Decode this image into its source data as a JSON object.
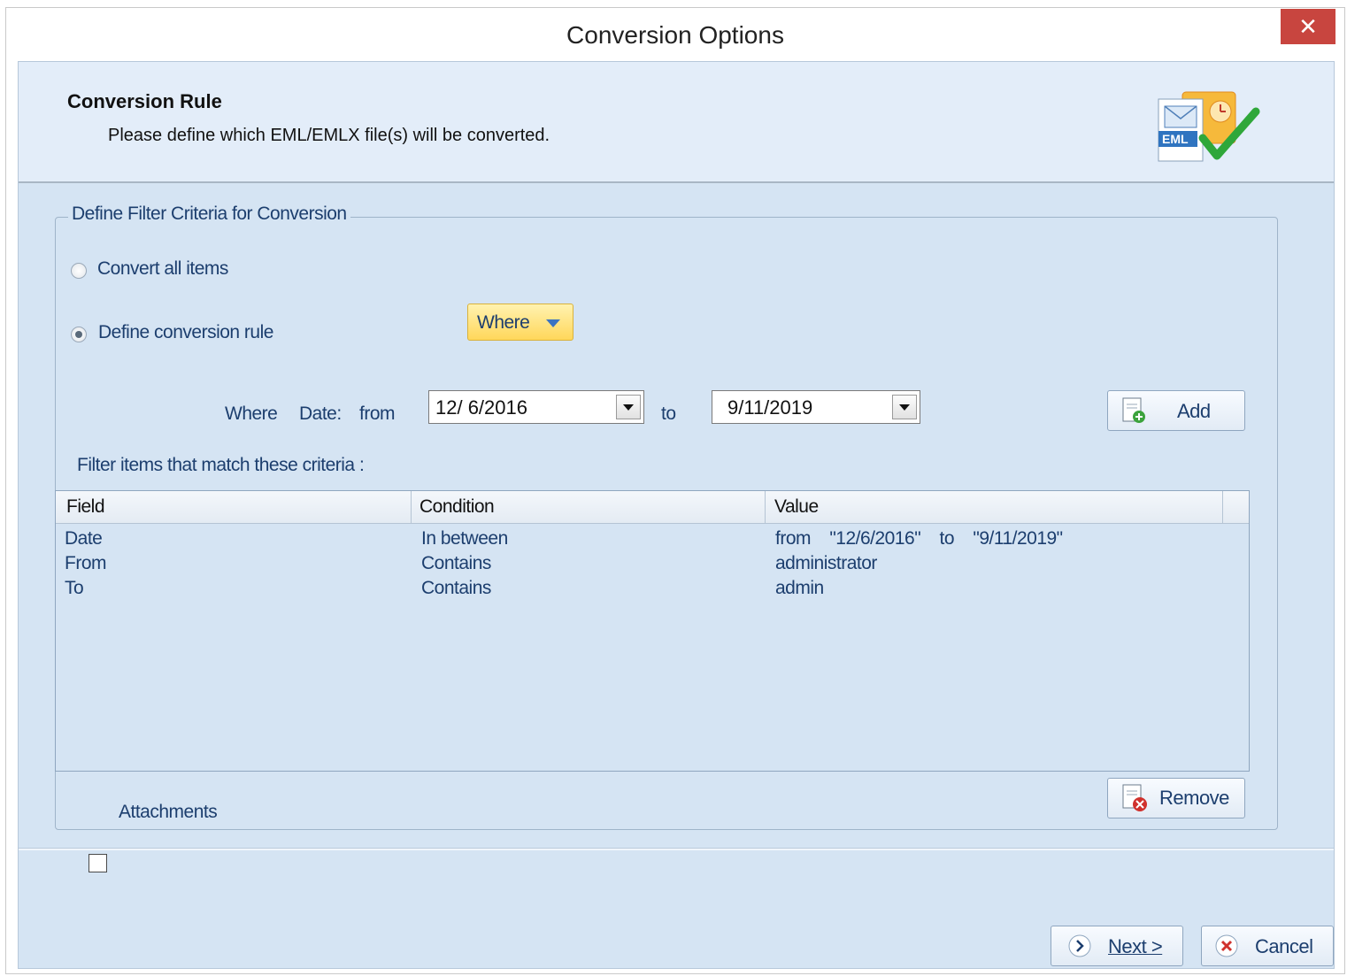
{
  "window": {
    "title": "Conversion Options",
    "close_glyph": "✕"
  },
  "header": {
    "title": "Conversion Rule",
    "subtitle": "Please define which EML/EMLX file(s) will be converted.",
    "icon_text": "EML"
  },
  "group": {
    "legend": "Define Filter Criteria for Conversion",
    "convert_all_label": "Convert all items",
    "define_rule_label": "Define conversion rule",
    "selected_option": "Define conversion rule",
    "where_button_label": "Where",
    "criteria": {
      "where_label": "Where",
      "field_label": "Date:",
      "from_label": "from",
      "from_value": "12/ 6/2016",
      "to_label": "to",
      "to_value": "9/11/2019"
    },
    "add_button_label": "Add",
    "filter_label": "Filter items that match these criteria :",
    "table": {
      "columns": [
        "Field",
        "Condition",
        "Value"
      ],
      "rows": [
        {
          "field": "Date",
          "condition": "In between",
          "value": "from    \"12/6/2016\"    to    \"9/11/2019\""
        },
        {
          "field": "From",
          "condition": "Contains",
          "value": "administrator"
        },
        {
          "field": "To",
          "condition": "Contains",
          "value": "admin"
        }
      ]
    },
    "attachments_label": "Attachments",
    "attachments_checked": false,
    "remove_button_label": "Remove"
  },
  "footer": {
    "next_button_label": "Next >",
    "cancel_button_label": "Cancel"
  }
}
